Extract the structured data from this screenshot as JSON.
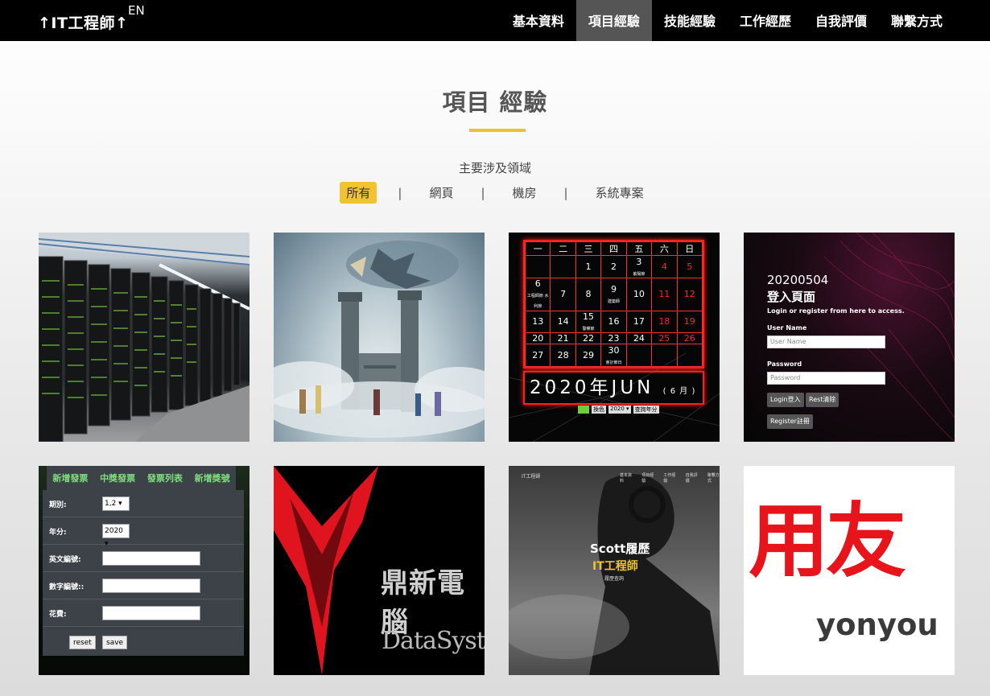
{
  "nav": {
    "brand": "↑IT工程師↑",
    "lang": "EN",
    "menu": [
      "基本資料",
      "項目經驗",
      "技能經驗",
      "工作經歷",
      "自我評價",
      "聯繫方式"
    ],
    "active_index": 1
  },
  "section": {
    "title": "項目 經驗",
    "subtitle": "主要涉及領域",
    "filters": [
      "所有",
      "網頁",
      "機房",
      "系統專案"
    ],
    "separator": "|",
    "active_filter": 0
  },
  "tiles": {
    "calendar": {
      "weekdays": [
        "一",
        "二",
        "三",
        "四",
        "五",
        "六",
        "日"
      ],
      "rows": [
        [
          "",
          "",
          "1",
          "2",
          "3",
          "4",
          "5"
        ],
        [
          "6",
          "7",
          "8",
          "9",
          "10",
          "11",
          "12"
        ],
        [
          "13",
          "14",
          "15",
          "16",
          "17",
          "18",
          "19"
        ],
        [
          "20",
          "21",
          "22",
          "23",
          "24",
          "25",
          "26"
        ],
        [
          "27",
          "28",
          "29",
          "30",
          "",
          "",
          ""
        ]
      ],
      "notes": {
        "3": "紫陽節",
        "6": "工程師節 水利節",
        "9": "建築師",
        "15": "警察節",
        "30": "會計節日"
      },
      "banner_main": "2020年JUN",
      "banner_sub": "( 6 月 )",
      "controls": [
        "換色",
        "2020 ▾",
        "查詢年分"
      ]
    },
    "login": {
      "date": "20200504",
      "heading": "登入頁面",
      "intro": "Login or register from here to access.",
      "user_label": "User Name",
      "user_placeholder": "User Name",
      "pass_label": "Password",
      "pass_placeholder": "Password",
      "login_btn": "Login登入",
      "reset_btn": "Rest清除",
      "register_btn": "Register註冊"
    },
    "invoice": {
      "tabs": [
        "新增發票",
        "中獎發票",
        "發票列表",
        "新增獎號"
      ],
      "period_label": "期別:",
      "period_value": "1,2 ▾",
      "year_label": "年分:",
      "year_value": "2020 ▾",
      "en_label": "英文編號:",
      "num_label": "數字編號::",
      "cost_label": "花費:",
      "reset_btn": "reset",
      "save_btn": "save"
    },
    "datasystems": {
      "cn": "鼎新電腦",
      "en": "DataSystems"
    },
    "resume": {
      "brand": "IT工程師",
      "menu": [
        "基本資料",
        "項目經驗",
        "工作經驗",
        "自我評價",
        "聯繫方式"
      ],
      "name": "Scott履歷",
      "role": "IT工程師",
      "sub": "履歷查詢"
    },
    "yonyou": {
      "cn": "用友",
      "en": "yonyou"
    }
  },
  "colors": {
    "accent": "#f1c232",
    "nav_bg": "#000000",
    "red": "#e8141c"
  }
}
